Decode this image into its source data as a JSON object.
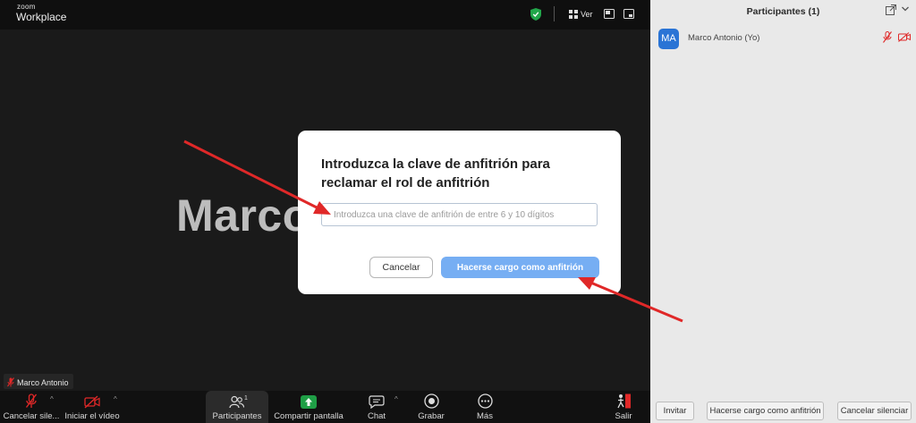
{
  "app": {
    "logo_small": "zoom",
    "logo_big": "Workplace"
  },
  "topbar": {
    "view_label": "Ver"
  },
  "meeting": {
    "big_name": "Marco",
    "name_chip": "Marco Antonio"
  },
  "toolbar": {
    "items": [
      {
        "label": "Cancelar sile...",
        "icon": "muted-mic-icon"
      },
      {
        "label": "Iniciar el vídeo",
        "icon": "video-off-icon"
      },
      {
        "label": "Participantes",
        "icon": "participants-icon",
        "count": "1"
      },
      {
        "label": "Compartir pantalla",
        "icon": "share-screen-icon"
      },
      {
        "label": "Chat",
        "icon": "chat-icon"
      },
      {
        "label": "Grabar",
        "icon": "record-icon"
      },
      {
        "label": "Más",
        "icon": "more-icon"
      },
      {
        "label": "Salir",
        "icon": "leave-icon"
      }
    ]
  },
  "dialog": {
    "title": "Introduzca la clave de anfitrión para reclamar el rol de anfitrión",
    "input_value": "",
    "input_placeholder": "Introduzca una clave de anfitrión de entre 6 y 10 dígitos",
    "cancel_label": "Cancelar",
    "claim_label": "Hacerse cargo como anfitrión"
  },
  "panel": {
    "title": "Participantes (1)",
    "participants": [
      {
        "initials": "MA",
        "name": "Marco Antonio (Yo)"
      }
    ],
    "buttons": {
      "invite": "Invitar",
      "claim_host": "Hacerse cargo como anfitrión",
      "unmute": "Cancelar silenciar"
    }
  },
  "colors": {
    "accent": "#76aef3",
    "avatar": "#2a74d5",
    "share_green": "#1f9e46",
    "alert_red": "#e02828"
  }
}
